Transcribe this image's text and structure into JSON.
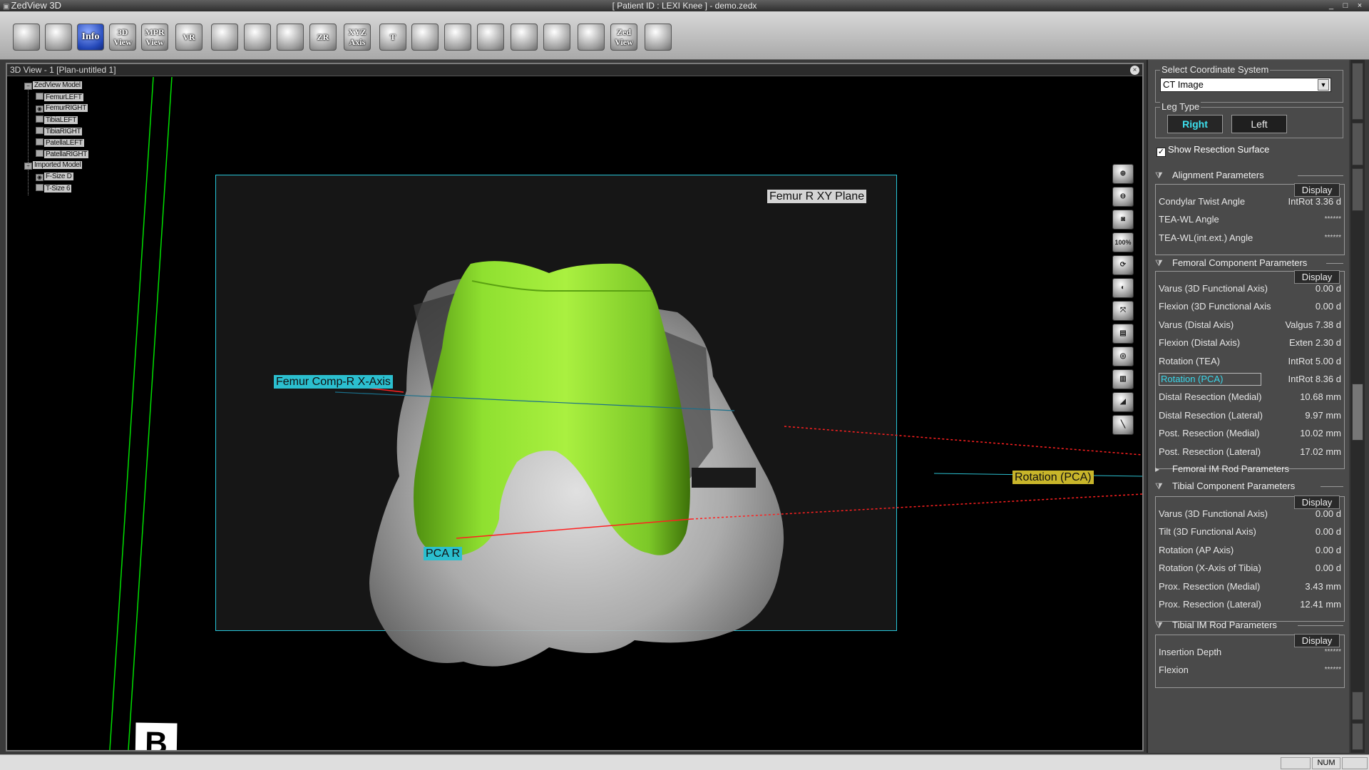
{
  "window": {
    "app_title": "ZedView 3D",
    "doc_title": "[ Patient ID : LEXI Knee ]  - demo.zedx",
    "minimize": "_",
    "restore": "□",
    "close": "×"
  },
  "toolbar": {
    "buttons": [
      {
        "name": "open-icon",
        "label": ""
      },
      {
        "name": "save-icon",
        "label": ""
      },
      {
        "name": "info-icon",
        "label": "Info"
      },
      {
        "name": "3d-view-icon",
        "label": "3D View"
      },
      {
        "name": "mpr-view-icon",
        "label": "MPR View"
      },
      {
        "name": "vr-icon",
        "label": "VR"
      },
      {
        "name": "layout-icon",
        "label": ""
      },
      {
        "name": "volume-icon",
        "label": ""
      },
      {
        "name": "camera-icon",
        "label": ""
      },
      {
        "name": "zoom-icon",
        "label": "ZR"
      },
      {
        "name": "xyz-axis-icon",
        "label": "XYZ Axis"
      },
      {
        "name": "text-icon",
        "label": "T"
      },
      {
        "name": "grid-icon",
        "label": ""
      },
      {
        "name": "cube-icon",
        "label": ""
      },
      {
        "name": "light-icon",
        "label": ""
      },
      {
        "name": "eye-icon",
        "label": ""
      },
      {
        "name": "box-icon",
        "label": ""
      },
      {
        "name": "ruler-icon",
        "label": ""
      },
      {
        "name": "zed-view-icon",
        "label": "Zed View"
      },
      {
        "name": "clock-icon",
        "label": ""
      }
    ]
  },
  "view": {
    "header": "3D View - 1 [Plan-untitled 1]",
    "close": "×",
    "tree": [
      {
        "label": "ZedView Model",
        "level": 0,
        "box": "−"
      },
      {
        "label": "FemurLEFT",
        "level": 1,
        "box": ""
      },
      {
        "label": "FemurRIGHT",
        "level": 1,
        "box": "◉"
      },
      {
        "label": "TibiaLEFT",
        "level": 1,
        "box": ""
      },
      {
        "label": "TibiaRIGHT",
        "level": 1,
        "box": ""
      },
      {
        "label": "PatellaLEFT",
        "level": 1,
        "box": ""
      },
      {
        "label": "PatellaRIGHT",
        "level": 1,
        "box": ""
      },
      {
        "label": "Imported Model",
        "level": 0,
        "box": "−"
      },
      {
        "label": "F-Size D",
        "level": 1,
        "box": "◉"
      },
      {
        "label": "T-Size 6",
        "level": 1,
        "box": ""
      }
    ],
    "tags": {
      "xy_plane": "Femur R XY Plane",
      "x_axis": "Femur Comp-R X-Axis",
      "pca": "PCA R",
      "rotation": "Rotation (PCA)"
    },
    "side_buttons": [
      "⊕",
      "⊖",
      "◙",
      "100%",
      "⟳",
      "◐",
      "⤧",
      "▤",
      "◎",
      "▥",
      "◢",
      "╲"
    ],
    "badge": "B"
  },
  "panel": {
    "coord": {
      "title": "Select Coordinate System",
      "value": "CT Image",
      "arrow": "▼"
    },
    "leg": {
      "title": "Leg Type",
      "right": "Right",
      "left": "Left"
    },
    "show_resection": {
      "label": "Show Resection Surface",
      "checked": "✓"
    },
    "alignment": {
      "title": "Alignment Parameters",
      "display": "Display",
      "rows": [
        {
          "name": "Condylar Twist Angle",
          "value": "IntRot 3.36 d"
        },
        {
          "name": "TEA-WL Angle",
          "value": "******"
        },
        {
          "name": "TEA-WL(int.ext.) Angle",
          "value": "******"
        }
      ]
    },
    "femoral": {
      "title": "Femoral Component Parameters",
      "display": "Display",
      "rows": [
        {
          "name": "Varus (3D Functional Axis)",
          "value": "0.00 d"
        },
        {
          "name": "Flexion (3D Functional Axis",
          "value": "0.00 d"
        },
        {
          "name": "Varus (Distal Axis)",
          "value": "Valgus 7.38 d"
        },
        {
          "name": "Flexion (Distal Axis)",
          "value": "Exten 2.30 d"
        },
        {
          "name": "Rotation (TEA)",
          "value": "IntRot 5.00 d"
        },
        {
          "name": "Rotation (PCA)",
          "value": "IntRot 8.36 d"
        },
        {
          "name": "Distal Resection (Medial)",
          "value": "10.68 mm"
        },
        {
          "name": "Distal Resection (Lateral)",
          "value": "9.97 mm"
        },
        {
          "name": "Post. Resection (Medial)",
          "value": "10.02 mm"
        },
        {
          "name": "Post. Resection (Lateral)",
          "value": "17.02 mm"
        }
      ]
    },
    "femoral_im": {
      "title": "Femoral IM Rod Parameters"
    },
    "tibial": {
      "title": "Tibial Component Parameters",
      "display": "Display",
      "rows": [
        {
          "name": "Varus (3D Functional Axis)",
          "value": "0.00 d"
        },
        {
          "name": "Tilt (3D Functional Axis)",
          "value": "0.00 d"
        },
        {
          "name": "Rotation (AP Axis)",
          "value": "0.00 d"
        },
        {
          "name": "Rotation (X-Axis of Tibia)",
          "value": "0.00 d"
        },
        {
          "name": "Prox. Resection (Medial)",
          "value": "3.43 mm"
        },
        {
          "name": "Prox. Resection (Lateral)",
          "value": "12.41 mm"
        }
      ]
    },
    "tibial_im": {
      "title": "Tibial IM Rod Parameters",
      "display": "Display",
      "rows": [
        {
          "name": "Insertion Depth",
          "value": "******"
        },
        {
          "name": "Flexion",
          "value": "******"
        }
      ]
    }
  },
  "status": {
    "num": "NUM"
  },
  "colors": {
    "implant": "#8fe030",
    "plane_border": "#27c6d9",
    "axis_line": "#00e000",
    "resection_line": "#ff2020"
  }
}
